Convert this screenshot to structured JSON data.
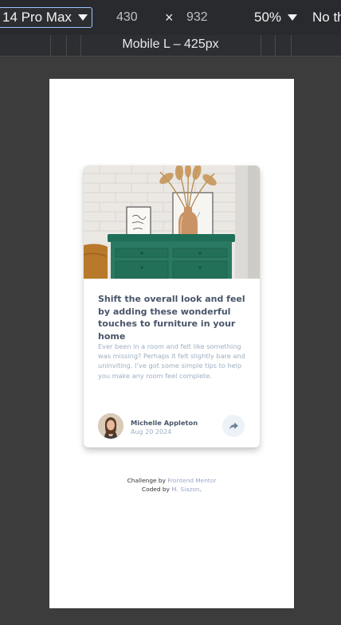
{
  "devtools": {
    "device_name": "14 Pro Max",
    "width_value": "430",
    "times": "×",
    "height_value": "932",
    "zoom": "50%",
    "throttle": "No th",
    "breakpoint_label": "Mobile L – 425px"
  },
  "card": {
    "title": "Shift the overall look and feel by adding these wonderful touches to furniture in your home",
    "description": "Ever been in a room and felt like something was missing? Perhaps it felt slightly bare and uninviting. I’ve got some simple tips to help you make any room feel complete.",
    "author": {
      "name": "Michelle Appleton",
      "date": "Aug 20 2024"
    },
    "share_icon": "share-arrow-icon"
  },
  "attribution": {
    "line1_prefix": "Challenge by ",
    "line1_link": "Frontend Mentor",
    "line2_prefix": "Coded by ",
    "line2_link": "M. Siazon",
    "line2_suffix": "."
  },
  "colors": {
    "title": "#48556a",
    "muted": "#9eafc2",
    "share_bg": "#ecf2f8",
    "link": "#9aa7c7",
    "drawer_green": "#2a7a63"
  }
}
